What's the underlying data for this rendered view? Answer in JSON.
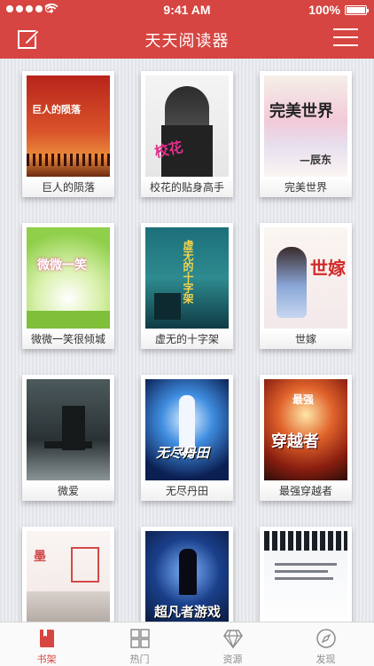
{
  "status_bar": {
    "time": "9:41 AM",
    "battery": "100%"
  },
  "nav": {
    "title": "天天阅读器"
  },
  "books": [
    {
      "title": "巨人的陨落"
    },
    {
      "title": "校花的贴身高手"
    },
    {
      "title": "完美世界"
    },
    {
      "title": "微微一笑很倾城"
    },
    {
      "title": "虚无的十字架"
    },
    {
      "title": "世嫁"
    },
    {
      "title": "微爱"
    },
    {
      "title": "无尽丹田"
    },
    {
      "title": "最强穿越者"
    },
    {
      "title": ""
    },
    {
      "title": ""
    },
    {
      "title": ""
    }
  ],
  "tabs": [
    {
      "label": "书架"
    },
    {
      "label": "热门"
    },
    {
      "label": "资源"
    },
    {
      "label": "发现"
    }
  ],
  "colors": {
    "accent": "#d64541",
    "inactive": "#8c8c8c"
  }
}
